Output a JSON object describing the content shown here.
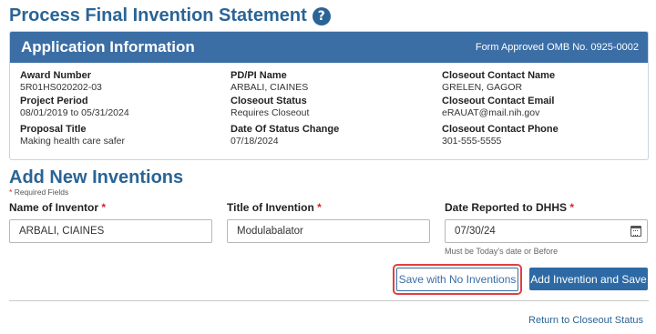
{
  "page": {
    "title": "Process Final Invention Statement",
    "help_icon": "?"
  },
  "app_info": {
    "header_title": "Application Information",
    "form_approval": "Form Approved OMB No. 0925-0002",
    "award_number_label": "Award Number",
    "award_number": "5R01HS020202-03",
    "project_period_label": "Project Period",
    "project_period": "08/01/2019 to 05/31/2024",
    "proposal_title_label": "Proposal Title",
    "proposal_title": "Making health care safer",
    "pdpi_name_label": "PD/PI Name",
    "pdpi_name": "ARBALI, CIAINES",
    "closeout_status_label": "Closeout Status",
    "closeout_status": "Requires Closeout",
    "status_change_label": "Date Of Status Change",
    "status_change": "07/18/2024",
    "contact_name_label": "Closeout Contact Name",
    "contact_name": "GRELEN, GAGOR",
    "contact_email_label": "Closeout Contact Email",
    "contact_email": "eRAUAT@mail.nih.gov",
    "contact_phone_label": "Closeout Contact Phone",
    "contact_phone": "301-555-5555"
  },
  "form": {
    "section_title": "Add New Inventions",
    "required_star": "*",
    "required_note": "Required Fields",
    "inventor_label": "Name of Inventor",
    "inventor_value": "ARBALI, CIAINES",
    "title_label": "Title of Invention",
    "title_value": "Modulabalator",
    "date_label": "Date Reported to DHHS",
    "date_value": "07/30/24",
    "date_hint": "Must be Today's date or Before"
  },
  "actions": {
    "save_no_inventions": "Save with No Inventions",
    "add_and_save": "Add Invention and Save",
    "return_link": "Return to Closeout Status"
  },
  "colors": {
    "primary": "#2d6aa5",
    "header_bg": "#3a6ea5",
    "highlight": "#e1403f",
    "required": "#d9242b"
  }
}
